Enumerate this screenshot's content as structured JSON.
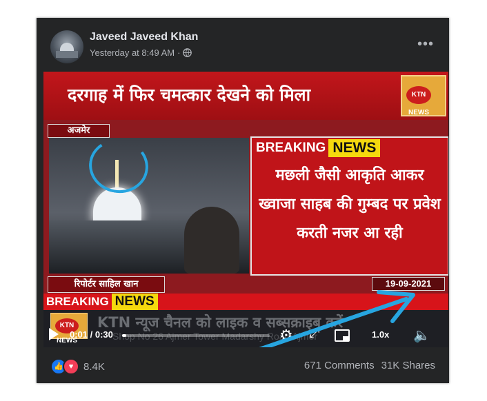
{
  "post": {
    "author": "Javeed Javeed Khan",
    "timestamp": "Yesterday at 8:49 AM",
    "privacy_icon": "globe-icon",
    "more_label": "•••"
  },
  "video": {
    "headline": "दरगाह में फिर चमत्कार देखने को मिला",
    "logo_text": "KTN NEWS",
    "location": "अजमेर",
    "breaking_label": "BREAKING",
    "news_label": "NEWS",
    "news_lines": "मछली जैसी आकृति आकर ख्वाजा साहब की गुम्बद पर प्रवेश करती नजर आ रही",
    "reporter": "रिपोर्टर साहिल खान",
    "date": "19-09-2021",
    "ticker_text": "KTN न्यूज चैनल को लाइक व सब्सक्राइब करें",
    "ticker_sub": "Shop No 26 Ajmer Tower Madarshy Road Ajmer",
    "player": {
      "current_time": "0:01",
      "duration": "0:30",
      "time_display": "0:01 / 0:30",
      "progress": 0.03,
      "speed": "1.0x"
    }
  },
  "footer": {
    "reaction_count": "8.4K",
    "comments": "671 Comments",
    "shares": "31K Shares"
  },
  "colors": {
    "card_bg": "#242526",
    "accent_red": "#c01419",
    "highlight_yellow": "#f5d90e",
    "annotation_arrow": "#27a5e0"
  }
}
